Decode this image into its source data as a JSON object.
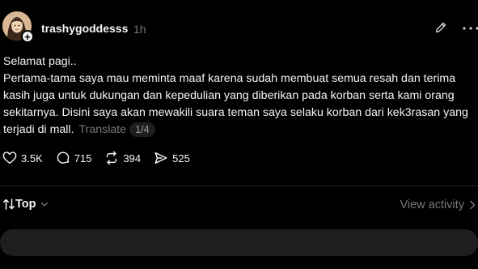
{
  "post": {
    "username": "trashygoddesss",
    "time": "1h",
    "paragraphs": [
      "Selamat pagi..",
      "Pertama-tama saya mau meminta maaf karena sudah membuat semua resah dan terima kasih juga untuk dukungan dan kepedulian yang diberikan pada korban serta kami orang sekitarnya. Disini saya akan mewakili suara teman saya selaku korban dari kek3rasan yang terjadi di mall."
    ],
    "translate_label": "Translate",
    "page_indicator": "1/4"
  },
  "actions": {
    "likes": "3.5K",
    "comments": "715",
    "reposts": "394",
    "shares": "525"
  },
  "replies": {
    "sort_label": "Top",
    "view_activity_label": "View activity"
  },
  "icons": {
    "follow": "plus-icon",
    "edit": "pencil-icon",
    "more": "more-dots-icon",
    "like": "heart-icon",
    "comment": "comment-bubble-icon",
    "repost": "repost-icon",
    "share": "send-icon",
    "sort": "sort-arrows-icon",
    "chevron": "chevron-down-icon",
    "arrow": "chevron-right-icon"
  }
}
